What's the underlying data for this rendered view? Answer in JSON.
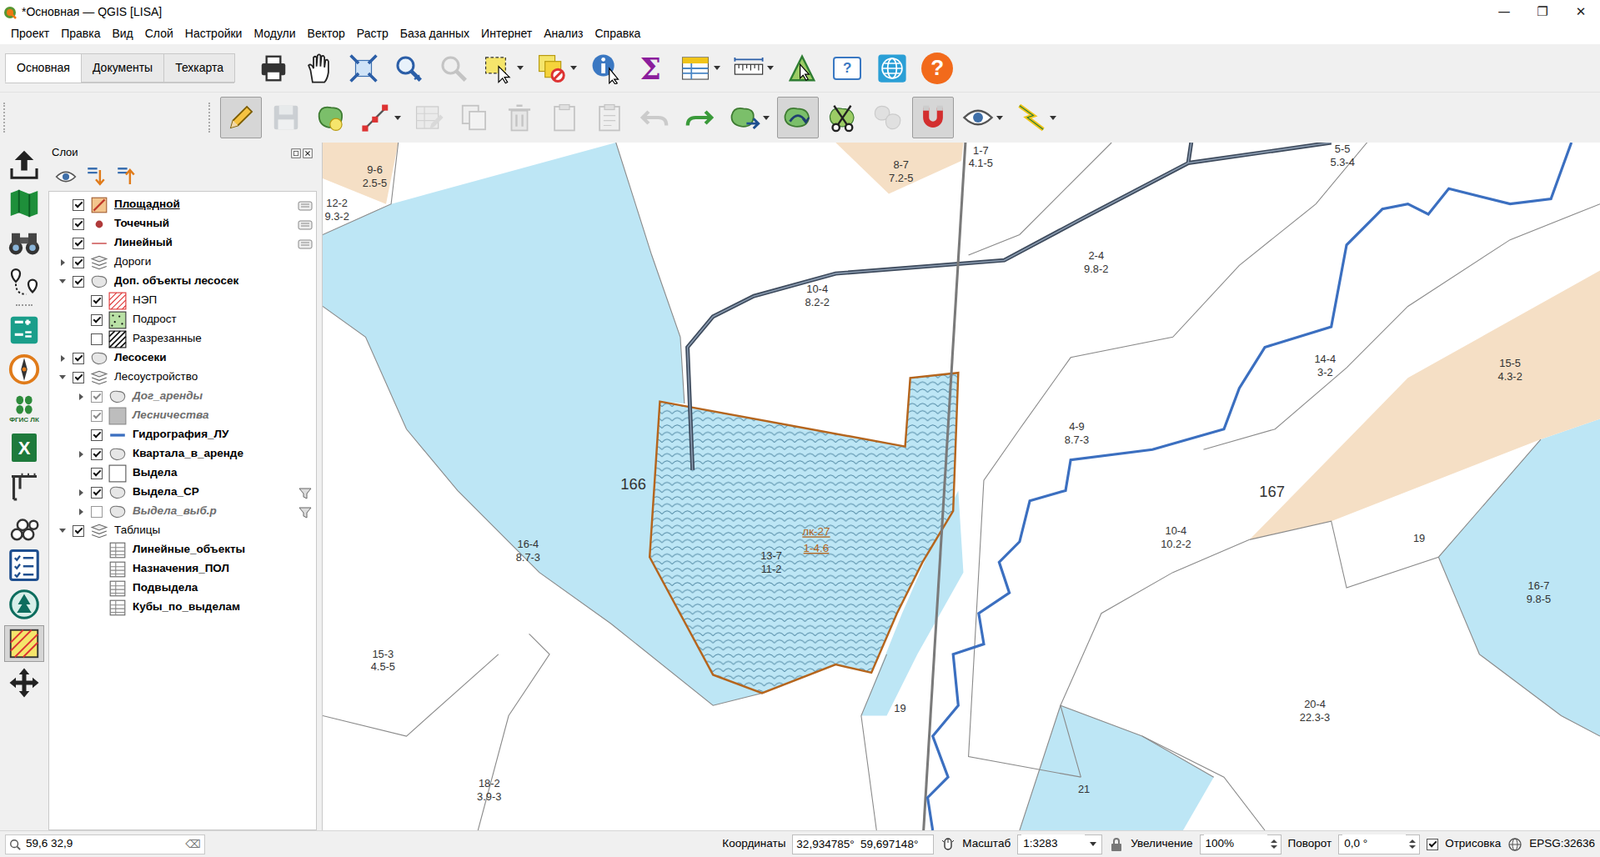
{
  "window": {
    "title": "*Основная — QGIS [LISA]",
    "controls": [
      "—",
      "❐",
      "✕"
    ]
  },
  "menu": [
    "Проект",
    "Правка",
    "Вид",
    "Слой",
    "Настройки",
    "Модули",
    "Вектор",
    "Растр",
    "База данных",
    "Интернет",
    "Анализ",
    "Справка"
  ],
  "tabs": [
    {
      "label": "Основная",
      "selected": true
    },
    {
      "label": "Документы",
      "selected": false
    },
    {
      "label": "Техкарта",
      "selected": false
    }
  ],
  "toolbar_main": [
    {
      "kind": "print",
      "dropdown": false,
      "pressed": false,
      "disabled": false
    },
    {
      "kind": "pan",
      "dropdown": false,
      "pressed": false,
      "disabled": false
    },
    {
      "kind": "zoom-full",
      "dropdown": false,
      "pressed": false,
      "disabled": false
    },
    {
      "kind": "zoom-last",
      "dropdown": false,
      "pressed": false,
      "disabled": false
    },
    {
      "kind": "zoom-next",
      "dropdown": false,
      "pressed": false,
      "disabled": true
    },
    {
      "kind": "select",
      "dropdown": true,
      "pressed": false,
      "disabled": false
    },
    {
      "kind": "deselect",
      "dropdown": true,
      "pressed": false,
      "disabled": false
    },
    {
      "kind": "identify",
      "dropdown": false,
      "pressed": false,
      "disabled": false
    },
    {
      "kind": "sigma",
      "glyph": "Σ",
      "dropdown": false,
      "pressed": false,
      "disabled": false
    },
    {
      "kind": "attribute-table",
      "dropdown": true,
      "pressed": false,
      "disabled": false
    },
    {
      "kind": "measure",
      "dropdown": true,
      "pressed": false,
      "disabled": false
    },
    {
      "kind": "vertex-pick",
      "dropdown": false,
      "pressed": false,
      "disabled": false
    },
    {
      "kind": "help-bubble",
      "glyph": "?",
      "dropdown": false,
      "pressed": false,
      "disabled": false
    },
    {
      "kind": "globe",
      "dropdown": false,
      "pressed": false,
      "disabled": false
    },
    {
      "kind": "help-orange",
      "glyph": "?",
      "dropdown": false,
      "pressed": false,
      "disabled": false
    }
  ],
  "toolbar_edit": [
    {
      "kind": "pencil",
      "dropdown": false,
      "pressed": true,
      "disabled": false
    },
    {
      "kind": "save",
      "dropdown": false,
      "pressed": false,
      "disabled": true
    },
    {
      "kind": "add-polygon",
      "dropdown": false,
      "pressed": false,
      "disabled": false
    },
    {
      "kind": "vertex-tool",
      "dropdown": true,
      "pressed": false,
      "disabled": false
    },
    {
      "kind": "edit-table",
      "dropdown": false,
      "pressed": false,
      "disabled": true
    },
    {
      "kind": "copy",
      "dropdown": false,
      "pressed": false,
      "disabled": true
    },
    {
      "kind": "delete",
      "dropdown": false,
      "pressed": false,
      "disabled": true
    },
    {
      "kind": "cut",
      "dropdown": false,
      "pressed": false,
      "disabled": true
    },
    {
      "kind": "paste",
      "dropdown": false,
      "pressed": false,
      "disabled": true
    },
    {
      "kind": "undo",
      "dropdown": false,
      "pressed": false,
      "disabled": true
    },
    {
      "kind": "redo",
      "dropdown": false,
      "pressed": false,
      "disabled": false
    },
    {
      "kind": "add-part",
      "dropdown": true,
      "pressed": false,
      "disabled": false
    },
    {
      "kind": "reshape",
      "dropdown": false,
      "pressed": true,
      "disabled": false
    },
    {
      "kind": "split",
      "dropdown": false,
      "pressed": false,
      "disabled": false
    },
    {
      "kind": "merge",
      "dropdown": false,
      "pressed": false,
      "disabled": true
    },
    {
      "kind": "snap",
      "dropdown": false,
      "pressed": true,
      "disabled": false
    },
    {
      "kind": "eye",
      "dropdown": true,
      "pressed": false,
      "disabled": false
    },
    {
      "kind": "lightning",
      "dropdown": true,
      "pressed": false,
      "disabled": false
    }
  ],
  "left_bar": [
    {
      "kind": "upload",
      "pressed": false
    },
    {
      "kind": "map",
      "pressed": false
    },
    {
      "kind": "binoculars",
      "pressed": false
    },
    {
      "kind": "route",
      "pressed": false
    },
    {
      "kind": "sep"
    },
    {
      "kind": "calculator",
      "pressed": false
    },
    {
      "kind": "compass",
      "pressed": false
    },
    {
      "kind": "fgis",
      "glyph": "ФГИС ЛК",
      "pressed": false
    },
    {
      "kind": "excel",
      "glyph": "X",
      "pressed": false
    },
    {
      "kind": "caliper",
      "pressed": false
    },
    {
      "kind": "logs",
      "pressed": false
    },
    {
      "kind": "checklist",
      "pressed": false
    },
    {
      "kind": "forest",
      "pressed": false
    },
    {
      "kind": "hatch",
      "pressed": true
    },
    {
      "kind": "move",
      "pressed": false
    }
  ],
  "layers_panel": {
    "title": "Слои",
    "layers": [
      {
        "label": "Площадной",
        "depth": 0,
        "kind": "polygon-edit",
        "checkable": true,
        "checked": true,
        "expandable": false,
        "expanded": false,
        "bold": true,
        "greyed": false,
        "selected": true,
        "badge": "edit"
      },
      {
        "label": "Точечный",
        "depth": 0,
        "kind": "point",
        "checkable": true,
        "checked": true,
        "expandable": false,
        "expanded": false,
        "bold": true,
        "greyed": false,
        "selected": false,
        "badge": "edit"
      },
      {
        "label": "Линейный",
        "depth": 0,
        "kind": "line-red",
        "checkable": true,
        "checked": true,
        "expandable": false,
        "expanded": false,
        "bold": true,
        "greyed": false,
        "selected": false,
        "badge": "edit"
      },
      {
        "label": "Дороги",
        "depth": 0,
        "kind": "group",
        "checkable": true,
        "checked": true,
        "expandable": true,
        "expanded": false,
        "bold": false,
        "greyed": false,
        "selected": false,
        "badge": "none"
      },
      {
        "label": "Доп. объекты лесосек",
        "depth": 0,
        "kind": "polygon-layer",
        "checkable": true,
        "checked": true,
        "expandable": true,
        "expanded": true,
        "bold": true,
        "greyed": false,
        "selected": false,
        "badge": "none"
      },
      {
        "label": "НЭП",
        "depth": 1,
        "kind": "swatch-red-hatch",
        "checkable": true,
        "checked": true,
        "expandable": false,
        "expanded": false,
        "bold": false,
        "greyed": false,
        "selected": false,
        "badge": "none"
      },
      {
        "label": "Подрост",
        "depth": 1,
        "kind": "swatch-green-dots",
        "checkable": true,
        "checked": true,
        "expandable": false,
        "expanded": false,
        "bold": false,
        "greyed": false,
        "selected": false,
        "badge": "none"
      },
      {
        "label": "Разрезанные",
        "depth": 1,
        "kind": "swatch-black-hatch",
        "checkable": true,
        "checked": false,
        "expandable": false,
        "expanded": false,
        "bold": false,
        "greyed": false,
        "selected": false,
        "badge": "none"
      },
      {
        "label": "Лесосеки",
        "depth": 0,
        "kind": "polygon-layer",
        "checkable": true,
        "checked": true,
        "expandable": true,
        "expanded": false,
        "bold": true,
        "greyed": false,
        "selected": false,
        "badge": "none"
      },
      {
        "label": "Лесоустройство",
        "depth": 0,
        "kind": "group",
        "checkable": true,
        "checked": true,
        "expandable": true,
        "expanded": true,
        "bold": false,
        "greyed": false,
        "selected": false,
        "badge": "none"
      },
      {
        "label": "Дог_аренды",
        "depth": 1,
        "kind": "polygon-layer",
        "checkable": true,
        "checked": true,
        "expandable": true,
        "expanded": false,
        "bold": false,
        "greyed": true,
        "selected": false,
        "badge": "none"
      },
      {
        "label": "Лесничества",
        "depth": 1,
        "kind": "swatch-gray",
        "checkable": true,
        "checked": true,
        "expandable": false,
        "expanded": false,
        "bold": false,
        "greyed": true,
        "selected": false,
        "badge": "none"
      },
      {
        "label": "Гидрография_ЛУ",
        "depth": 1,
        "kind": "line-blue",
        "checkable": true,
        "checked": true,
        "expandable": false,
        "expanded": false,
        "bold": true,
        "greyed": false,
        "selected": false,
        "badge": "none"
      },
      {
        "label": "Квартала_в_аренде",
        "depth": 1,
        "kind": "polygon-layer",
        "checkable": true,
        "checked": true,
        "expandable": true,
        "expanded": false,
        "bold": true,
        "greyed": false,
        "selected": false,
        "badge": "none"
      },
      {
        "label": "Выдела",
        "depth": 1,
        "kind": "swatch-white",
        "checkable": true,
        "checked": true,
        "expandable": false,
        "expanded": false,
        "bold": true,
        "greyed": false,
        "selected": false,
        "badge": "none"
      },
      {
        "label": "Выдела_СР",
        "depth": 1,
        "kind": "polygon-layer",
        "checkable": true,
        "checked": true,
        "expandable": true,
        "expanded": false,
        "bold": true,
        "greyed": false,
        "selected": false,
        "badge": "filter"
      },
      {
        "label": "Выдела_выб.р",
        "depth": 1,
        "kind": "polygon-layer",
        "checkable": true,
        "checked": false,
        "expandable": true,
        "expanded": false,
        "bold": false,
        "greyed": true,
        "selected": false,
        "badge": "filter"
      },
      {
        "label": "Таблицы",
        "depth": 0,
        "kind": "group",
        "checkable": true,
        "checked": true,
        "expandable": true,
        "expanded": true,
        "bold": false,
        "greyed": false,
        "selected": false,
        "badge": "none"
      },
      {
        "label": "Линейные_объекты",
        "depth": 1,
        "kind": "table",
        "checkable": false,
        "checked": false,
        "expandable": false,
        "expanded": false,
        "bold": true,
        "greyed": false,
        "selected": false,
        "badge": "none"
      },
      {
        "label": "Назначения_ПОЛ",
        "depth": 1,
        "kind": "table",
        "checkable": false,
        "checked": false,
        "expandable": false,
        "expanded": false,
        "bold": true,
        "greyed": false,
        "selected": false,
        "badge": "none"
      },
      {
        "label": "Подвыдела",
        "depth": 1,
        "kind": "table",
        "checkable": false,
        "checked": false,
        "expandable": false,
        "expanded": false,
        "bold": true,
        "greyed": false,
        "selected": false,
        "badge": "none"
      },
      {
        "label": "Кубы_по_выделам",
        "depth": 1,
        "kind": "table",
        "checkable": false,
        "checked": false,
        "expandable": false,
        "expanded": false,
        "bold": true,
        "greyed": false,
        "selected": false,
        "badge": "none"
      }
    ]
  },
  "map": {
    "stands": [
      {
        "name": "9-6",
        "info": "2.5-5"
      },
      {
        "name": "12-2",
        "info": "9.3-2"
      },
      {
        "name": "8-7",
        "info": "7.2-5"
      },
      {
        "name": "1-7",
        "info": "4.1-5"
      },
      {
        "name": "5-5",
        "info": "5.3-4"
      },
      {
        "name": "2-4",
        "info": "9.8-2"
      },
      {
        "name": "10-4",
        "info": "8.2-2"
      },
      {
        "name": "14-4",
        "info": "3-2"
      },
      {
        "name": "15-5",
        "info": "4.3-2"
      },
      {
        "name": "4-9",
        "info": "8.7-3"
      },
      {
        "name": "16-4",
        "info": "8.7-3"
      },
      {
        "name": "13-7",
        "info": "11-2"
      },
      {
        "name": "10-4",
        "info": "10.2-2"
      },
      {
        "name": "19",
        "info": ""
      },
      {
        "name": "16-7",
        "info": "9.8-5"
      },
      {
        "name": "15-3",
        "info": "4.5-5"
      },
      {
        "name": "19",
        "info": ""
      },
      {
        "name": "20-4",
        "info": "22.3-3"
      },
      {
        "name": "18-2",
        "info": "3.9-3"
      },
      {
        "name": "21",
        "info": ""
      }
    ],
    "quarters": [
      "166",
      "167"
    ],
    "plot": {
      "name": "лк-27",
      "info": "1-4.6"
    }
  },
  "status_bar": {
    "search": {
      "value": "59,6 32,9",
      "clear": "⌫"
    },
    "coordinates_label": "Координаты",
    "coordinates": "32,934785°  59,697148°",
    "scale_label": "Масштаб",
    "scale": "1:3283",
    "magnifier_label": "Увеличение",
    "magnifier": "100%",
    "rotation_label": "Поворот",
    "rotation": "0,0 °",
    "render": {
      "label": "Отрисовка",
      "checked": true
    },
    "crs": "EPSG:32636"
  }
}
